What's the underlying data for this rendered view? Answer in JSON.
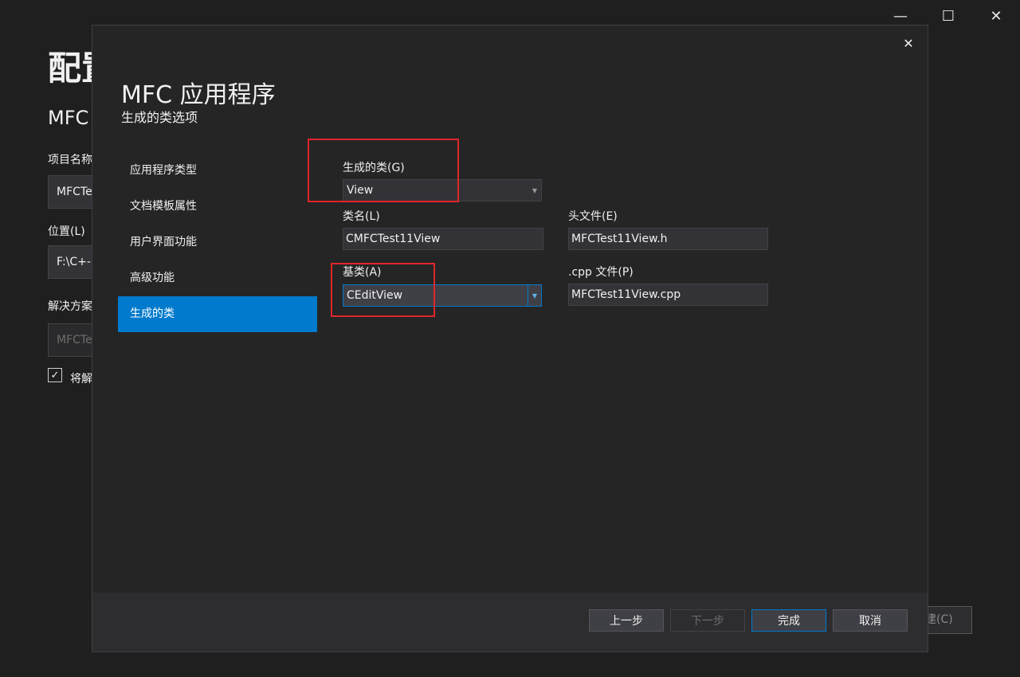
{
  "background_window": {
    "title": "配置",
    "subtitle": "MFC",
    "project_name_label": "项目名称",
    "project_name_value": "MFCTe",
    "location_label": "位置(L)",
    "location_value": "F:\\C+-",
    "solution_label": "解决方案",
    "solution_value": "MFCTe",
    "checkbox_label": "将解",
    "checkbox_checked": true,
    "create_button_label": "建(C)"
  },
  "window_controls": {
    "minimize": "—",
    "maximize": "☐",
    "close": "✕"
  },
  "dialog": {
    "title": "MFC 应用程序",
    "subtitle": "生成的类选项",
    "close_glyph": "✕",
    "nav": [
      {
        "label": "应用程序类型",
        "active": false
      },
      {
        "label": "文档模板属性",
        "active": false
      },
      {
        "label": "用户界面功能",
        "active": false
      },
      {
        "label": "高级功能",
        "active": false
      },
      {
        "label": "生成的类",
        "active": true
      }
    ],
    "form": {
      "generated_class_label": "生成的类(G)",
      "generated_class_value": "View",
      "class_name_label": "类名(L)",
      "class_name_value": "CMFCTest11View",
      "header_file_label": "头文件(E)",
      "header_file_value": "MFCTest11View.h",
      "base_class_label": "基类(A)",
      "base_class_value": "CEditView",
      "cpp_file_label": ".cpp 文件(P)",
      "cpp_file_value": "MFCTest11View.cpp"
    },
    "footer": {
      "prev_label": "上一步",
      "next_label": "下一步",
      "finish_label": "完成",
      "cancel_label": "取消"
    }
  },
  "colors": {
    "accent": "#007acc",
    "highlight": "#e0262a",
    "dialog_bg": "#252526",
    "footer_bg": "#2d2d30"
  }
}
